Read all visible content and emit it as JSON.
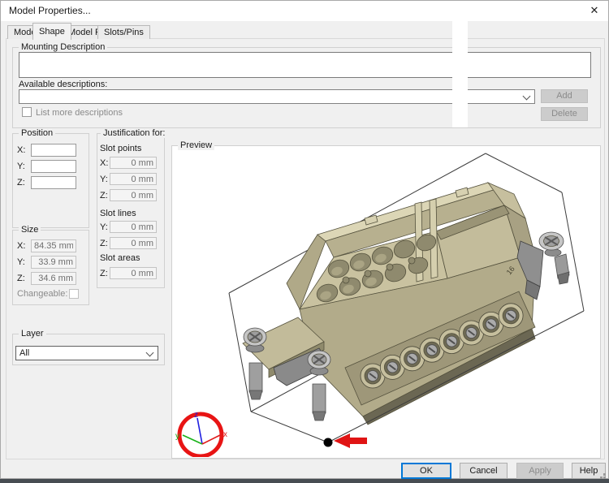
{
  "window": {
    "title": "Model Properties...",
    "close_glyph": "✕"
  },
  "tabs": [
    {
      "label": "Model"
    },
    {
      "label": "Shape"
    },
    {
      "label": "Model Pins"
    },
    {
      "label": "Slots/Pins"
    }
  ],
  "mounting": {
    "group_label": "Mounting Description",
    "input_value": "",
    "available_label": "Available descriptions:",
    "combo_value": "",
    "list_more_label": "List more descriptions",
    "add_label": "Add",
    "delete_label": "Delete"
  },
  "position": {
    "group_label": "Position",
    "rows": [
      {
        "label": "X:",
        "value": ""
      },
      {
        "label": "Y:",
        "value": ""
      },
      {
        "label": "Z:",
        "value": ""
      }
    ]
  },
  "justification": {
    "group_label": "Justification for:",
    "sections": [
      {
        "title": "Slot points",
        "rows": [
          {
            "label": "X:",
            "value": "0 mm"
          },
          {
            "label": "Y:",
            "value": "0 mm"
          },
          {
            "label": "Z:",
            "value": "0 mm"
          }
        ]
      },
      {
        "title": "Slot lines",
        "rows": [
          {
            "label": "Y:",
            "value": "0 mm"
          },
          {
            "label": "Z:",
            "value": "0 mm"
          }
        ]
      },
      {
        "title": "Slot areas",
        "rows": [
          {
            "label": "Z:",
            "value": "0 mm"
          }
        ]
      }
    ]
  },
  "size": {
    "group_label": "Size",
    "rows": [
      {
        "label": "X:",
        "value": "84.35 mm"
      },
      {
        "label": "Y:",
        "value": "33.9 mm"
      },
      {
        "label": "Z:",
        "value": "34.6 mm"
      }
    ],
    "changeable_label": "Changeable:"
  },
  "layer": {
    "group_label": "Layer",
    "value": "All"
  },
  "preview": {
    "group_label": "Preview",
    "axis_labels": {
      "x": "x",
      "y": "y",
      "z": "z"
    },
    "model_marking": "16"
  },
  "buttons": {
    "ok": "OK",
    "cancel": "Cancel",
    "apply": "Apply",
    "help": "Help"
  },
  "colors": {
    "accent_focus": "#0078d7",
    "annotation_red": "#e81414",
    "axis_x": "#e01919",
    "axis_y": "#19b219",
    "axis_z": "#1f1fe0",
    "model_tan": "#c9c2a0",
    "dialog_bg": "#f0f0f0"
  }
}
